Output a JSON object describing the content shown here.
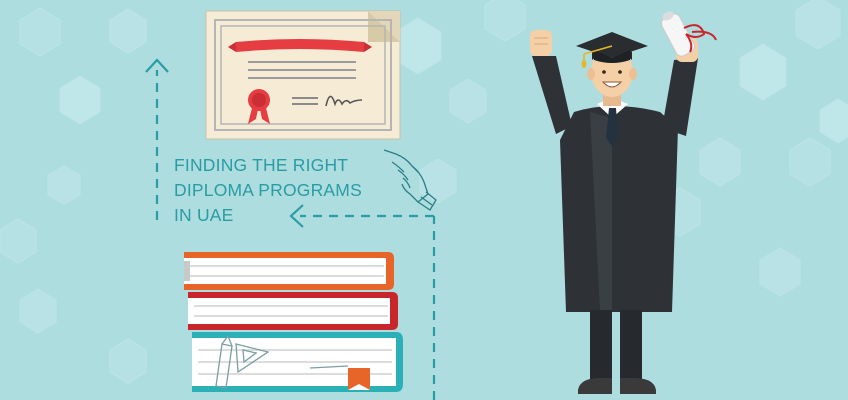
{
  "headline": {
    "line1": "FINDING THE RIGHT",
    "line2": "DIPLOMA PROGRAMS",
    "line3": "IN UAE"
  },
  "colors": {
    "background": "#aedde0",
    "hexagon": "#bfe6e8",
    "accent_teal": "#2a9ca4",
    "certificate_paper": "#f6ecd6",
    "ribbon_red": "#e53d42",
    "book_orange": "#e8652a",
    "book_red": "#c9262c",
    "book_teal": "#2bb0b8",
    "gown": "#2e3236",
    "skin": "#f5cfa6"
  },
  "icons": {
    "certificate": "certificate-icon",
    "pointing_hand": "pointing-hand-icon",
    "books": "stacked-books-icon",
    "graduate": "graduate-icon",
    "diploma_scroll": "diploma-scroll-icon",
    "mortarboard": "mortarboard-icon"
  }
}
